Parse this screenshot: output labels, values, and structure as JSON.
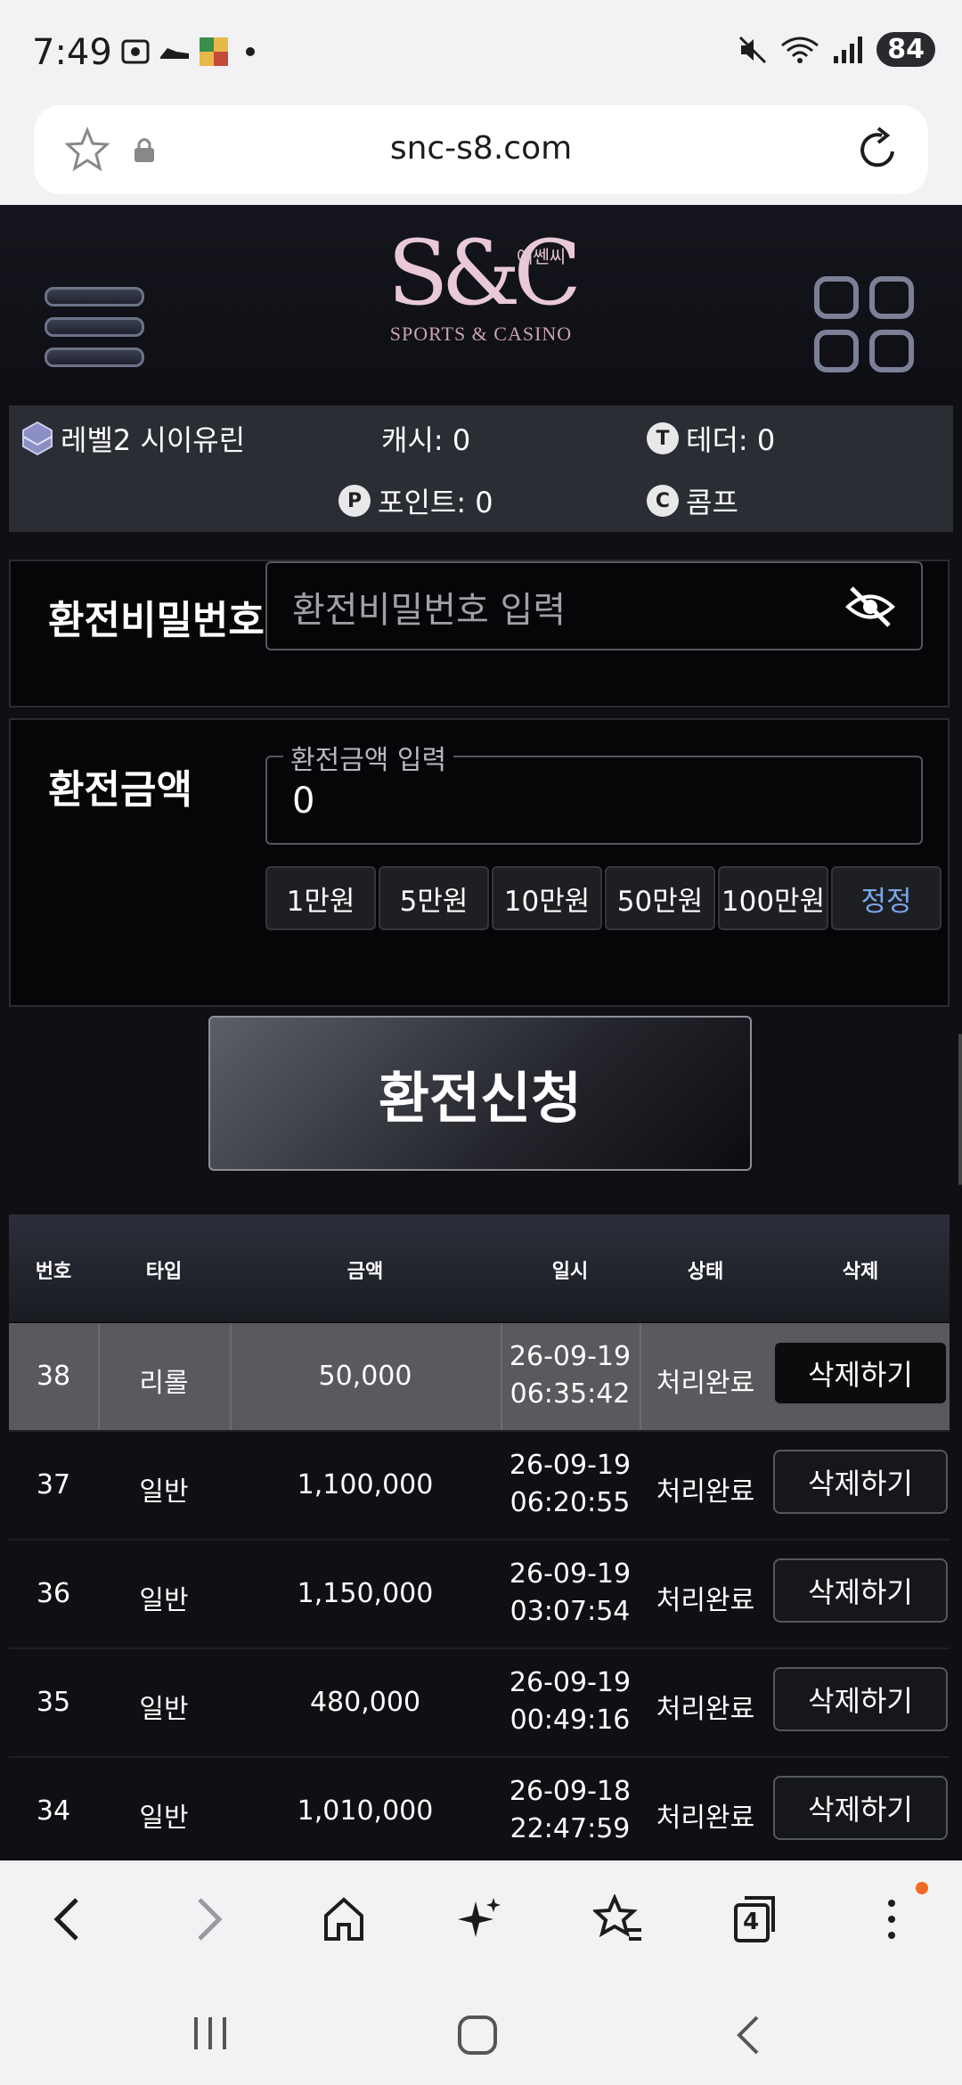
{
  "status": {
    "time": "7:49",
    "battery": "84"
  },
  "browser": {
    "url": "snc-s8.com",
    "tabs_count": "4"
  },
  "site": {
    "logo_mark": "S&C",
    "logo_sub": "SPORTS & CASINO",
    "logo_kr": "에쎈씨"
  },
  "user": {
    "level_name": "레벨2 시이유린",
    "cash": "캐시: 0",
    "tether": "테더: 0",
    "point": "포인트: 0",
    "comp": "콤프"
  },
  "form": {
    "password_label": "환전비밀번호",
    "password_placeholder": "환전비밀번호 입력",
    "amount_label": "환전금액",
    "amount_legend": "환전금액 입력",
    "amount_value": "0",
    "chips": [
      "1만원",
      "5만원",
      "10만원",
      "50만원",
      "100만원"
    ],
    "reset_label": "정정",
    "submit_label": "환전신청"
  },
  "table": {
    "headers": [
      "번호",
      "타입",
      "금액",
      "일시",
      "상태",
      "삭제"
    ],
    "rows": [
      {
        "no": "38",
        "type": "리롤",
        "amount": "50,000",
        "date": "26-09-19",
        "time": "06:35:42",
        "status": "처리완료",
        "action": "삭제하기"
      },
      {
        "no": "37",
        "type": "일반",
        "amount": "1,100,000",
        "date": "26-09-19",
        "time": "06:20:55",
        "status": "처리완료",
        "action": "삭제하기"
      },
      {
        "no": "36",
        "type": "일반",
        "amount": "1,150,000",
        "date": "26-09-19",
        "time": "03:07:54",
        "status": "처리완료",
        "action": "삭제하기"
      },
      {
        "no": "35",
        "type": "일반",
        "amount": "480,000",
        "date": "26-09-19",
        "time": "00:49:16",
        "status": "처리완료",
        "action": "삭제하기"
      },
      {
        "no": "34",
        "type": "일반",
        "amount": "1,010,000",
        "date": "26-09-18",
        "time": "22:47:59",
        "status": "처리완료",
        "action": "삭제하기"
      }
    ]
  }
}
